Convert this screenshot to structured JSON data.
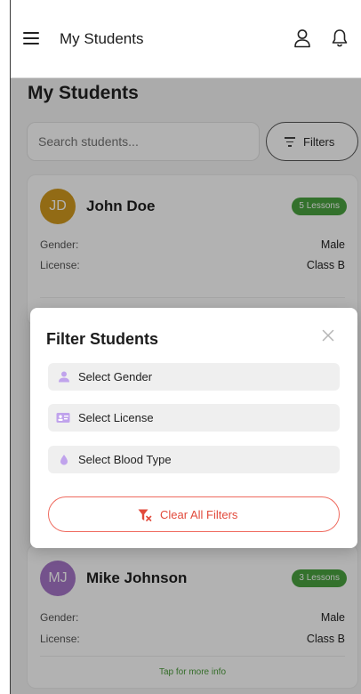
{
  "header": {
    "title": "My Students",
    "menu_icon": "menu-icon",
    "profile_icon": "user-icon",
    "notification_icon": "bell-icon"
  },
  "page": {
    "title": "My Students"
  },
  "search": {
    "placeholder": "Search students...",
    "icon": "none"
  },
  "filters_button": {
    "label": "Filters",
    "icon": "filter-lines-icon"
  },
  "students": [
    {
      "initials": "JD",
      "name": "John Doe",
      "lessons": "5 Lessons",
      "gender_label": "Gender:",
      "gender": "Male",
      "license_label": "License:",
      "license": "Class B",
      "avatar_color": "#d19a1f"
    },
    {
      "initials": "MJ",
      "name": "Mike Johnson",
      "lessons": "3 Lessons",
      "gender_label": "Gender:",
      "gender": "Male",
      "license_label": "License:",
      "license": "Class B",
      "more_info": "Tap for more info",
      "avatar_color": "#a676c9"
    }
  ],
  "filter_modal": {
    "title": "Filter Students",
    "options": [
      {
        "label": "Select Gender",
        "icon": "person-icon"
      },
      {
        "label": "Select License",
        "icon": "id-card-icon"
      },
      {
        "label": "Select Blood Type",
        "icon": "blood-drop-icon"
      }
    ],
    "clear_label": "Clear All Filters",
    "clear_icon": "filter-clear-icon"
  },
  "colors": {
    "accent_purple": "#c0a3ec",
    "badge_green": "#49a33f",
    "clear_red": "#e24a3b",
    "overlay": "rgba(0,0,0,0.3)"
  }
}
